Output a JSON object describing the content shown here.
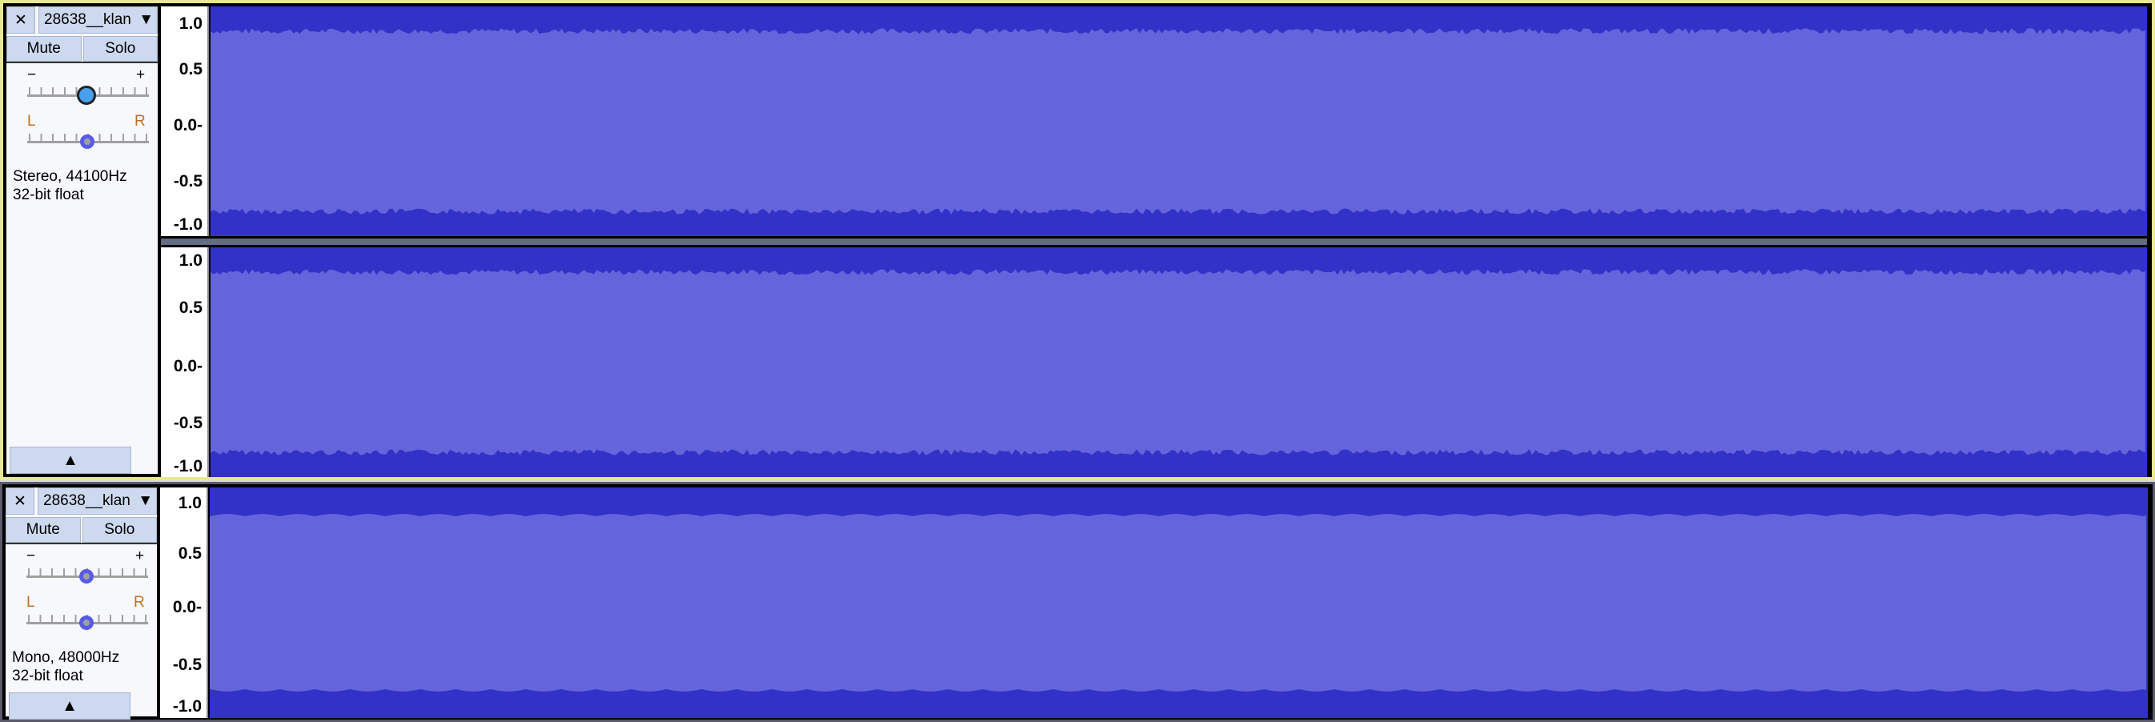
{
  "tracks": [
    {
      "name": "28638__klan",
      "close_icon": "close-icon",
      "menu_icon": "dropdown-triangle-icon",
      "mute": "Mute",
      "solo": "Solo",
      "gain_min": "−",
      "gain_max": "+",
      "pan_left": "L",
      "pan_right": "R",
      "format": "Stereo, 44100Hz",
      "bit_depth": "32-bit float",
      "selected": true,
      "gain": 0.5,
      "pan": 0.5,
      "channels": 2,
      "axis": [
        "1.0",
        "0.5",
        "0.0-",
        "-0.5",
        "-1.0"
      ]
    },
    {
      "name": "28638__klan",
      "close_icon": "close-icon",
      "menu_icon": "dropdown-triangle-icon",
      "mute": "Mute",
      "solo": "Solo",
      "gain_min": "−",
      "gain_max": "+",
      "pan_left": "L",
      "pan_right": "R",
      "format": "Mono, 48000Hz",
      "bit_depth": "32-bit float",
      "selected": false,
      "gain": 0.5,
      "pan": 0.5,
      "channels": 1,
      "axis": [
        "1.0",
        "0.5",
        "0.0-",
        "-0.5",
        "-1.0"
      ]
    }
  ],
  "symbols": {
    "close": "✕",
    "menu": "▼",
    "collapse": "▲"
  },
  "colors": {
    "wave_bg": "#3232c8",
    "wave_fill": "#6464dc",
    "selected_border": "#e8e890"
  }
}
